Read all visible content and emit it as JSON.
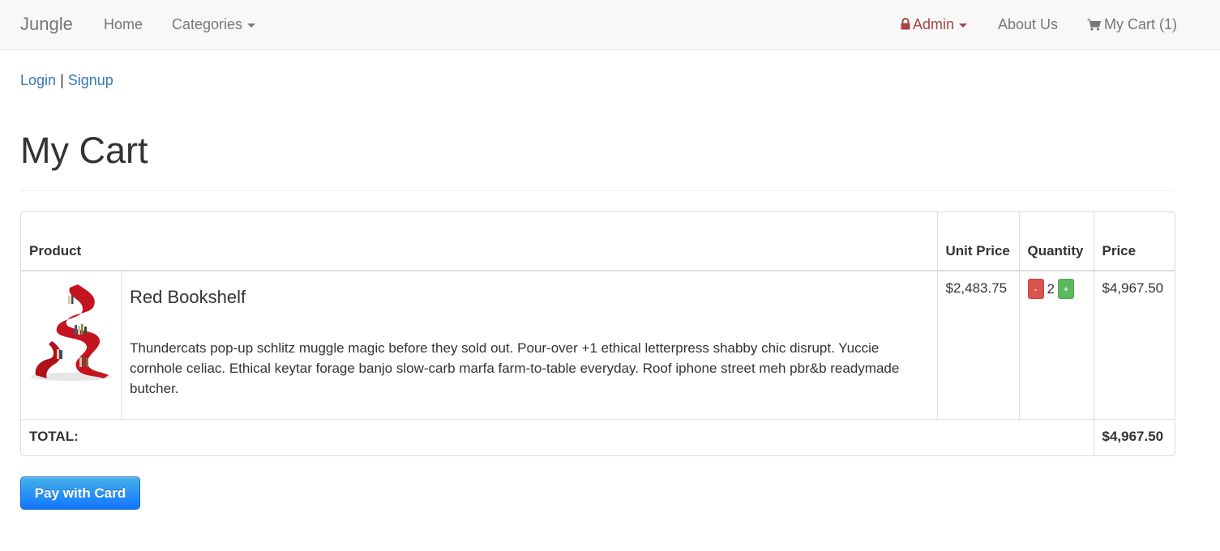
{
  "navbar": {
    "brand": "Jungle",
    "home": "Home",
    "categories": "Categories",
    "admin": "Admin",
    "about": "About Us",
    "cart": "My Cart (1)"
  },
  "auth": {
    "login": "Login",
    "separator": "|",
    "signup": "Signup"
  },
  "page": {
    "title": "My Cart"
  },
  "table": {
    "headers": {
      "product": "Product",
      "unit_price": "Unit Price",
      "quantity": "Quantity",
      "price": "Price"
    },
    "items": [
      {
        "name": "Red Bookshelf",
        "description": "Thundercats pop-up schlitz muggle magic before they sold out. Pour-over +1 ethical letterpress shabby chic disrupt. Yuccie cornhole celiac. Ethical keytar forage banjo slow-carb marfa farm-to-table everyday. Roof iphone street meh pbr&b readymade butcher.",
        "unit_price": "$2,483.75",
        "quantity": "2",
        "minus_label": "-",
        "plus_label": "+",
        "price": "$4,967.50"
      }
    ],
    "total_label": "TOTAL:",
    "total_value": "$4,967.50"
  },
  "pay_button": "Pay with Card",
  "colors": {
    "link": "#337ab7",
    "admin": "#a94442",
    "minus": "#d9534f",
    "plus": "#5cb85c",
    "pay": "#1a8ee6"
  }
}
